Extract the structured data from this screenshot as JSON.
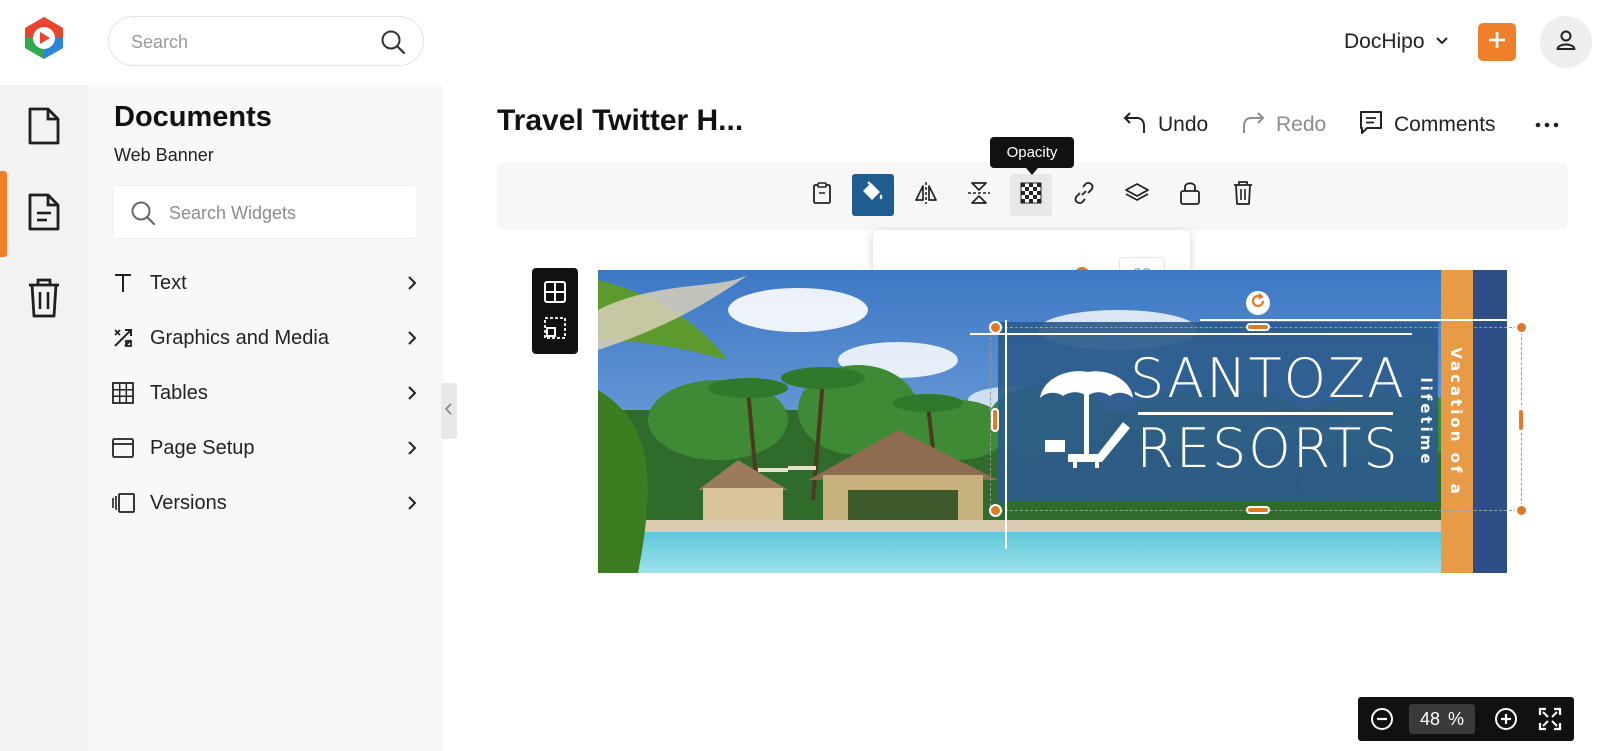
{
  "header": {
    "search": {
      "placeholder": "Search",
      "value": ""
    },
    "account_name": "DocHipo",
    "icons": {
      "logo": "dochipo-logo",
      "search": "search-icon",
      "add": "plus-icon",
      "user": "user-icon",
      "chevron": "chevron-down-icon"
    }
  },
  "rail": {
    "items": [
      {
        "name": "documents-icon",
        "active": false
      },
      {
        "name": "template-icon",
        "active": true
      },
      {
        "name": "trash-icon",
        "active": false
      }
    ]
  },
  "panel": {
    "title": "Documents",
    "subtitle": "Web Banner",
    "search": {
      "placeholder": "Search Widgets",
      "value": ""
    },
    "items": [
      {
        "label": "Text",
        "icon": "text-icon"
      },
      {
        "label": "Graphics and Media",
        "icon": "graphics-icon"
      },
      {
        "label": "Tables",
        "icon": "table-icon"
      },
      {
        "label": "Page Setup",
        "icon": "page-setup-icon"
      },
      {
        "label": "Versions",
        "icon": "versions-icon"
      }
    ]
  },
  "document": {
    "title": "Travel Twitter H...",
    "undo_label": "Undo",
    "redo_label": "Redo",
    "comments_label": "Comments"
  },
  "toolbar": {
    "tools": [
      "clipboard-icon",
      "fill-color-icon",
      "flip-horizontal-icon",
      "flip-vertical-icon",
      "opacity-icon",
      "link-icon",
      "layers-icon",
      "lock-icon",
      "delete-icon"
    ],
    "active_tool": "fill-color-icon",
    "tooltip": "Opacity"
  },
  "opacity": {
    "value": 92,
    "display": "92"
  },
  "banner": {
    "brand_line1": "SANTOZA",
    "brand_line2": "RESORTS",
    "tagline": "Vacation of a lifetime",
    "colors": {
      "panel": "#2d5b8c",
      "stripe": "#e79b47",
      "accent": "#e07a2a"
    }
  },
  "zoom": {
    "value": "48",
    "unit": "%"
  }
}
